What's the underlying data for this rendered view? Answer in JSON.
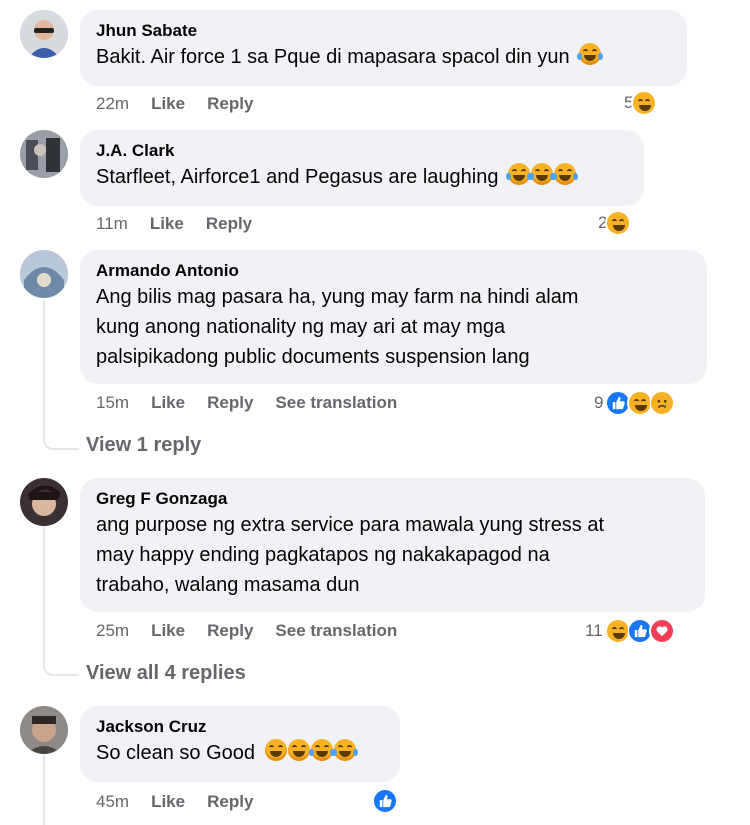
{
  "comments": [
    {
      "author": "Jhun Sabate",
      "lines": [
        "Bakit. Air force 1 sa Pque di mapasara spacol din yun"
      ],
      "time": "22m",
      "like": "Like",
      "reply": "Reply",
      "reaction_count": "5",
      "reactions": [
        "haha"
      ]
    },
    {
      "author": "J.A. Clark",
      "lines": [
        "Starfleet, Airforce1 and Pegasus are laughing"
      ],
      "time": "11m",
      "like": "Like",
      "reply": "Reply",
      "reaction_count": "2",
      "reactions": [
        "haha"
      ]
    },
    {
      "author": "Armando Antonio",
      "lines": [
        "Ang bilis mag pasara ha, yung may farm na hindi alam",
        "kung anong nationality ng may ari at may mga",
        "palsipikadong public documents suspension lang"
      ],
      "time": "15m",
      "like": "Like",
      "reply": "Reply",
      "see_translation": "See translation",
      "reaction_count": "9",
      "reactions": [
        "like",
        "haha",
        "sad"
      ],
      "view_replies": "View 1 reply"
    },
    {
      "author": "Greg F Gonzaga",
      "lines": [
        "ang purpose ng extra service para mawala yung stress at",
        "may happy ending pagkatapos ng nakakapagod na",
        "trabaho, walang masama dun"
      ],
      "time": "25m",
      "like": "Like",
      "reply": "Reply",
      "see_translation": "See translation",
      "reaction_count": "11",
      "reactions": [
        "haha",
        "like",
        "love"
      ],
      "view_replies": "View all 4 replies"
    },
    {
      "author": "Jackson Cruz",
      "lines": [
        "So clean so Good"
      ],
      "time": "45m",
      "like": "Like",
      "reply": "Reply",
      "reactions": [
        "like"
      ]
    }
  ],
  "colors": {
    "bubble": "#f0f2f5",
    "meta": "#65676b",
    "like_blue": "#1877f2",
    "love_red": "#f33e58",
    "haha_yellow": "#f7b125"
  }
}
